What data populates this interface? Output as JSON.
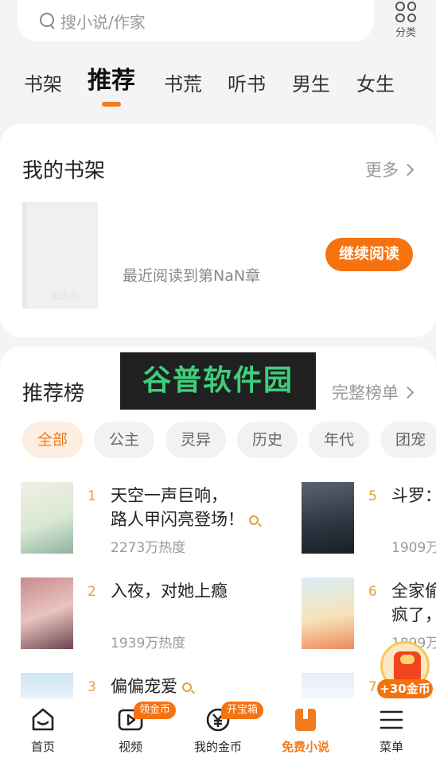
{
  "search": {
    "placeholder": "搜小说/作家"
  },
  "category": {
    "label": "分类"
  },
  "tabs": [
    "书架",
    "推荐",
    "书荒",
    "听书",
    "男生",
    "女生"
  ],
  "shelf": {
    "title": "我的书架",
    "more": "更多",
    "cover_text": "未读过",
    "last_read": "最近阅读到第NaN章",
    "continue_label": "继续阅读"
  },
  "watermark": "谷普软件园",
  "rank_section": {
    "title": "推荐榜",
    "more": "完整榜单",
    "chips": [
      "全部",
      "公主",
      "灵异",
      "历史",
      "年代",
      "团宠"
    ],
    "items": [
      {
        "rank": "1",
        "title_line1": "天空一声巨响，",
        "title_line2": "路人甲闪亮登场！",
        "heat": "2273万热度"
      },
      {
        "rank": "2",
        "title_line1": "入夜，对她上瘾",
        "title_line2": "",
        "heat": "1939万热度"
      },
      {
        "rank": "3",
        "title_line1": "偏偏宠爱",
        "title_line2": "",
        "heat": ""
      },
      {
        "rank": "5",
        "title_line1": "斗罗：",
        "title_line2": "",
        "heat": "1909万"
      },
      {
        "rank": "6",
        "title_line1": "全家偷",
        "title_line2": "疯了，",
        "heat": "1899万"
      },
      {
        "rank": "7",
        "title_line1": "",
        "title_line2": "",
        "heat": ""
      }
    ]
  },
  "coin_float": {
    "label": "+30金币"
  },
  "nav": [
    {
      "label": "首页",
      "badge": ""
    },
    {
      "label": "视频",
      "badge": "领金币"
    },
    {
      "label": "我的金币",
      "badge": "开宝箱"
    },
    {
      "label": "免费小说",
      "badge": ""
    },
    {
      "label": "菜单",
      "badge": ""
    }
  ],
  "colors": {
    "accent": "#f27b1d",
    "button": "#f5720f",
    "rank": "#e0a13b"
  }
}
